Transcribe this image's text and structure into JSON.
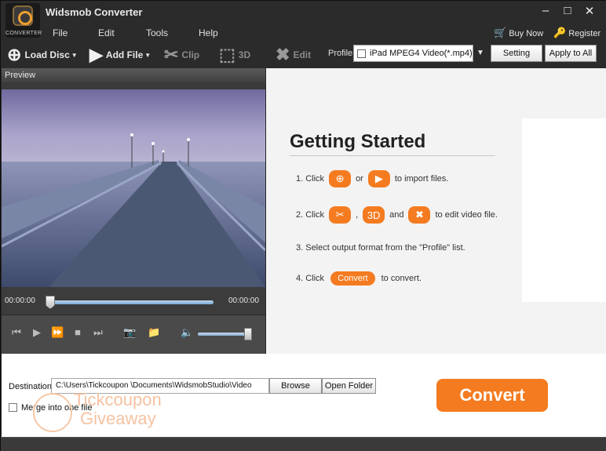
{
  "app": {
    "title": "Widsmob Converter",
    "logo_caption": "CONVERTER"
  },
  "menu": [
    "File",
    "Edit",
    "Tools",
    "Help"
  ],
  "window_controls": {
    "minimize": "–",
    "maximize": "□",
    "close": "✕"
  },
  "topbar": {
    "buy_now": "Buy Now",
    "register": "Register"
  },
  "toolbar": {
    "load_disc": "Load Disc",
    "add_file": "Add File",
    "clip": "Clip",
    "three_d": "3D",
    "edit": "Edit",
    "profile_label": "Profile:",
    "profile_value": "iPad MPEG4 Video(*.mp4)",
    "setting": "Setting",
    "apply_to_all": "Apply to All"
  },
  "preview": {
    "header": "Preview",
    "time_current": "00:00:00",
    "time_total": "00:00:00",
    "seek_position": 0.0,
    "volume_level": 1.0
  },
  "getting_started": {
    "title": "Getting Started",
    "step1": {
      "prefix": "1. Click",
      "or": "or",
      "suffix": "to import files."
    },
    "step2": {
      "prefix": "2. Click",
      "comma": ",",
      "and": "and",
      "suffix": "to edit video file."
    },
    "step3": "3. Select output format from the \"Profile\" list.",
    "step4": {
      "prefix": "4. Click",
      "button": "Convert",
      "suffix": "to convert."
    }
  },
  "bottom": {
    "destination_label": "Destination:",
    "destination_value": "C:\\Users\\Tickcoupon \\Documents\\WidsmobStudio\\Video",
    "browse": "Browse",
    "open_folder": "Open Folder",
    "merge_label": "Merge into one file",
    "merge_checked": false,
    "convert": "Convert",
    "watermark_line1": "Tickcoupon",
    "watermark_line2": "Giveaway"
  }
}
